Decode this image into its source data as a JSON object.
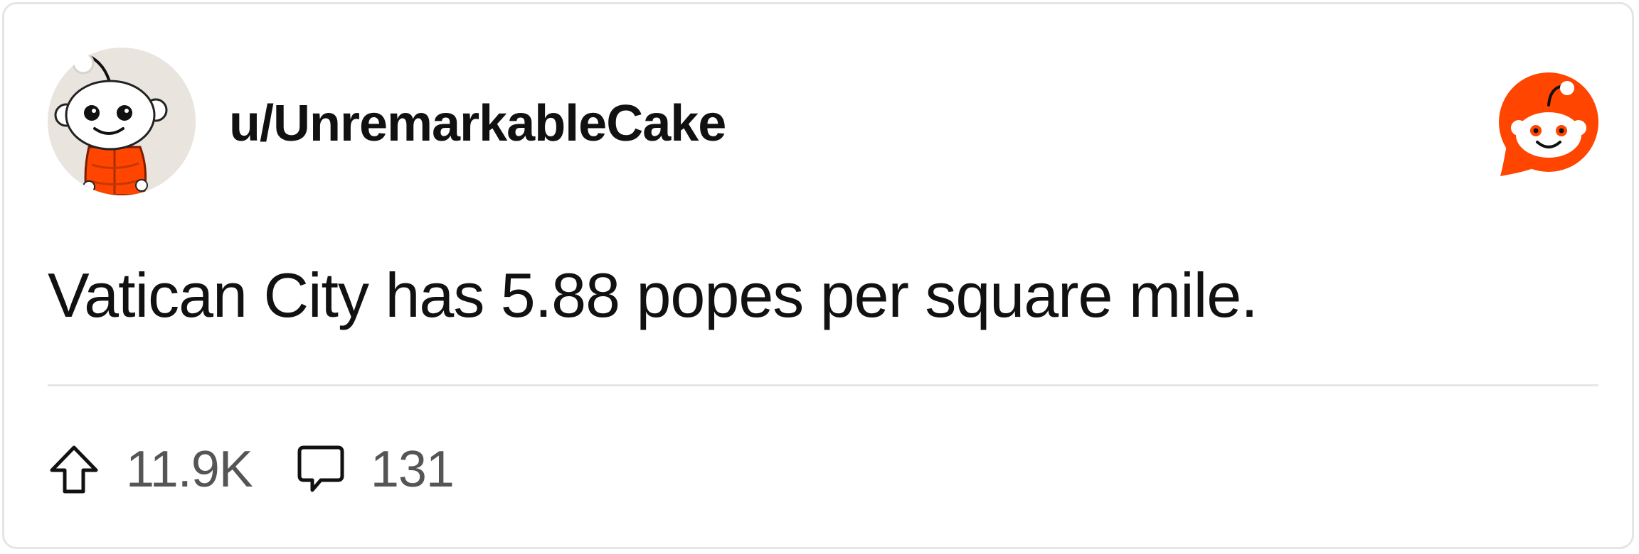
{
  "post": {
    "username": "u/UnremarkableCake",
    "text": "Vatican City has 5.88 popes per square mile.",
    "upvotes": "11.9K",
    "comments": "131"
  },
  "icons": {
    "avatar": "snoo-avatar",
    "brand": "reddit-logo-icon",
    "upvote": "upvote-arrow-icon",
    "comment": "comment-bubble-icon"
  },
  "colors": {
    "brand": "#ff4500",
    "text": "#111111",
    "muted": "#555555",
    "divider": "#e6e6e6",
    "avatar_bg": "#e9e4dd",
    "jacket": "#ff4500"
  }
}
